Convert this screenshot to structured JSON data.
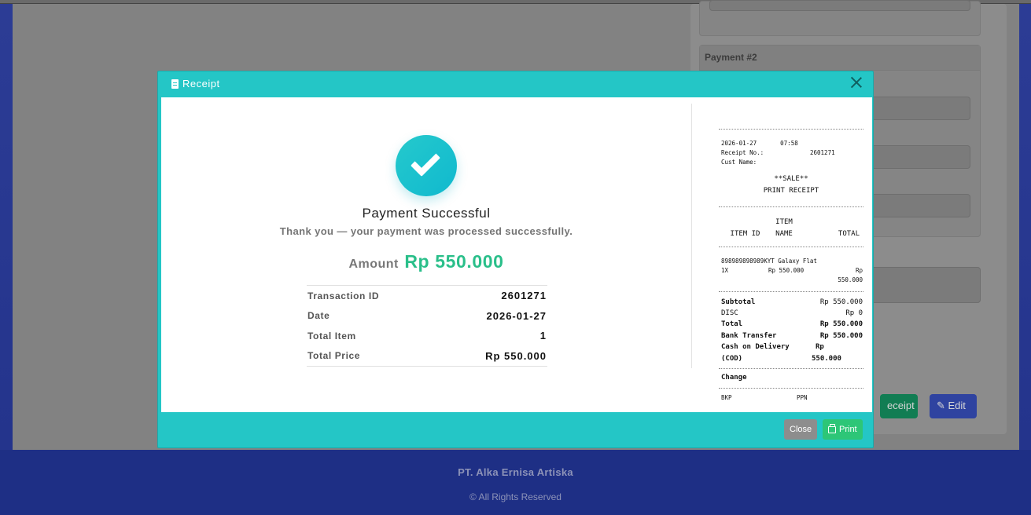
{
  "background": {
    "card_title": "Payment #2",
    "receipt_button_label": "eceipt",
    "edit_button_label": "Edit"
  },
  "footer": {
    "company": "PT. Alka Ernisa Artiska",
    "rights": "© All Rights Reserved"
  },
  "modal": {
    "title": "Receipt",
    "close_label": "Close",
    "print_label": "Print"
  },
  "success": {
    "title": "Payment Successful",
    "subtitle": "Thank you — your payment was processed successfully.",
    "amount_label": "Amount",
    "amount_value": "Rp 550.000",
    "details": [
      {
        "label": "Transaction ID",
        "value": "2601271"
      },
      {
        "label": "Date",
        "value": "2026-01-27"
      },
      {
        "label": "Total Item",
        "value": "1"
      },
      {
        "label": "Total Price",
        "value": "Rp 550.000"
      }
    ]
  },
  "receipt": {
    "date": "2026-01-27",
    "time": "07:58",
    "receipt_no_label": "Receipt No.:",
    "receipt_no": "2601271",
    "cust_name_label": "Cust Name:",
    "sale_label": "**SALE**",
    "print_label": "PRINT RECEIPT",
    "col_item_id": "ITEM ID",
    "col_item_name_1": "ITEM",
    "col_item_name_2": "NAME",
    "col_total": "TOTAL",
    "item_id": "898989898989",
    "item_name": "KYT Galaxy Flat",
    "item_qty": "1X",
    "item_price": "Rp 550.000",
    "item_total_1": "Rp",
    "item_total_2": "550.000",
    "subtotal_label": "Subtotal",
    "subtotal_value": "Rp 550.000",
    "disc_label": "DISC",
    "disc_value": "Rp 0",
    "total_label": "Total",
    "total_value": "Rp 550.000",
    "bank_label": "Bank Transfer",
    "bank_value": "Rp 550.000",
    "cod_label_1": "Cash on Delivery",
    "cod_label_2": "(COD)",
    "cod_value_1": "Rp",
    "cod_value_2": "550.000",
    "change_label": "Change",
    "bkp_label": "BKP",
    "ppn_label": "PPN"
  }
}
